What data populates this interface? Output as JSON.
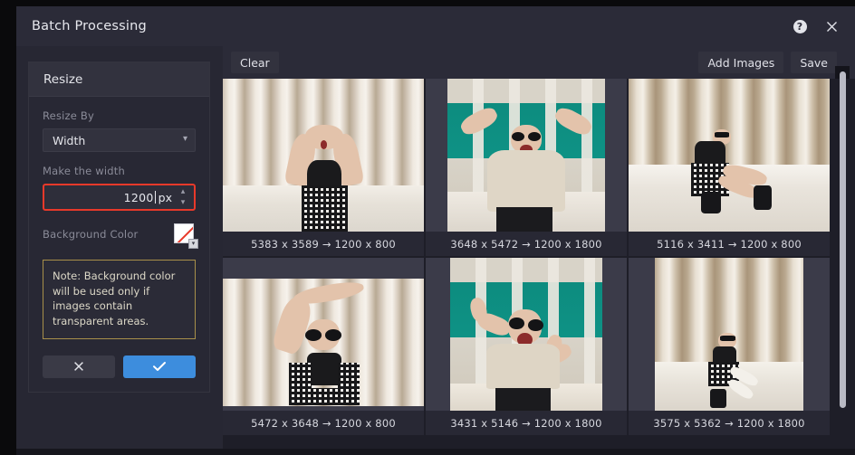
{
  "window": {
    "title": "Batch Processing",
    "help_icon": "help-circle-icon",
    "close_icon": "close-icon"
  },
  "sidebar": {
    "panel_title": "Resize",
    "resize_by": {
      "label": "Resize By",
      "value": "Width",
      "chevron": "chevron-down-icon"
    },
    "width_field": {
      "label": "Make the width",
      "value": "1200",
      "unit": "px",
      "spin_up": "chevron-up-icon",
      "spin_down": "chevron-down-icon"
    },
    "background_color": {
      "label": "Background Color",
      "swatch": "transparent-swatch",
      "chevron": "chevron-down-icon"
    },
    "note": "Note: Background color will be used only if images contain transparent areas.",
    "buttons": {
      "cancel_icon": "close-icon",
      "confirm_icon": "check-icon"
    }
  },
  "toolbar": {
    "clear_label": "Clear",
    "add_images_label": "Add Images",
    "save_label": "Save"
  },
  "grid": {
    "items": [
      {
        "caption": "5383 x 3589 → 1200 x 800",
        "orientation": "landscape",
        "art": "hands-over-eyes"
      },
      {
        "caption": "3648 x 5472 → 1200 x 1800",
        "orientation": "portrait",
        "art": "arms-up-teal"
      },
      {
        "caption": "5116 x 3411 → 1200 x 800",
        "orientation": "landscape",
        "art": "seated-blinds"
      },
      {
        "caption": "5472 x 3648 → 1200 x 800",
        "orientation": "landscape",
        "art": "arm-overhead"
      },
      {
        "caption": "3431 x 5146 → 1200 x 1800",
        "orientation": "portrait",
        "art": "peace-signs-teal"
      },
      {
        "caption": "3575 x 5362 → 1200 x 1800",
        "orientation": "portrait",
        "art": "seated-curtain"
      }
    ]
  },
  "colors": {
    "accent_blue": "#3d8ddd",
    "highlight_red": "#e8392a",
    "note_border": "#a8904a",
    "panel_bg": "#282834",
    "window_bg": "#2b2b38"
  }
}
